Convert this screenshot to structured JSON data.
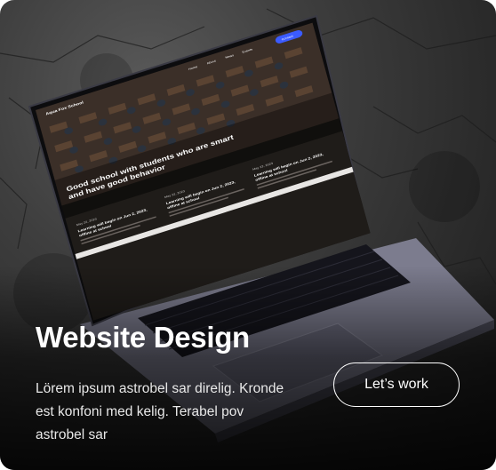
{
  "card": {
    "title": "Website Design",
    "description": "Lörem ipsum astrobel sar direlig. Kronde est konfoni med kelig. Terabel pov astrobel sar",
    "cta_label": "Let’s work"
  },
  "mockup_site": {
    "logo": "Aqua Fox School",
    "nav_items": [
      "Home",
      "About",
      "News",
      "Events"
    ],
    "contact_label": "Contact",
    "hero_heading_line1": "Good school with students who are smart",
    "hero_heading_line2": "and have good behavior",
    "news": [
      {
        "date": "May 22, 2023",
        "title_line1": "Learning will begin on Jun 2, 2023,",
        "title_line2": "offline at school"
      },
      {
        "date": "May 22, 2023",
        "title_line1": "Learning will begin on Jun 2, 2023,",
        "title_line2": "offline at school"
      },
      {
        "date": "May 22, 2023",
        "title_line1": "Learning will begin on Jun 2, 2023,",
        "title_line2": "offline at school"
      }
    ]
  },
  "colors": {
    "accent": "#3b5bff",
    "card_text": "#ffffff",
    "screen_bg": "#1a1714"
  }
}
